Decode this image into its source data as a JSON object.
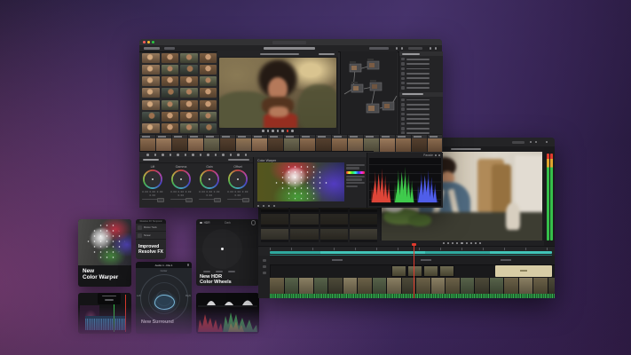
{
  "main_window": {
    "color_wheels": {
      "labels": [
        "Lift",
        "Gamma",
        "Gain",
        "Offset"
      ],
      "values": "0.00  0.00  0.00  0.00"
    },
    "color_warper": {
      "title": "Color Warper"
    },
    "scopes": {
      "title": "Parade"
    }
  },
  "cards": {
    "color_warper": {
      "title_lines": [
        "New",
        "Color Warper"
      ]
    },
    "resolve_fx": {
      "panel_header": "Resolve FX Temporal",
      "items": [
        {
          "label": "Motion Trails"
        },
        {
          "label": "Smear"
        }
      ],
      "title_lines": [
        "Improved",
        "Resolve FX"
      ]
    },
    "hdr_wheels": {
      "mode_left": "HDR",
      "mode_center": "Dark",
      "title_lines": [
        "New HDR",
        "Color Wheels"
      ]
    },
    "surround": {
      "header": "Audio 1 - Dia 1",
      "label_center": "Center",
      "label_left": "Left",
      "label_right": "Right",
      "title": "New Surround"
    }
  },
  "colors": {
    "accent_teal": "#41c4b8",
    "playhead_red": "#e23b2e",
    "audio_green": "#35c04a",
    "traffic_red": "#ff5f57",
    "traffic_yellow": "#febc2e",
    "traffic_green": "#28c840"
  }
}
